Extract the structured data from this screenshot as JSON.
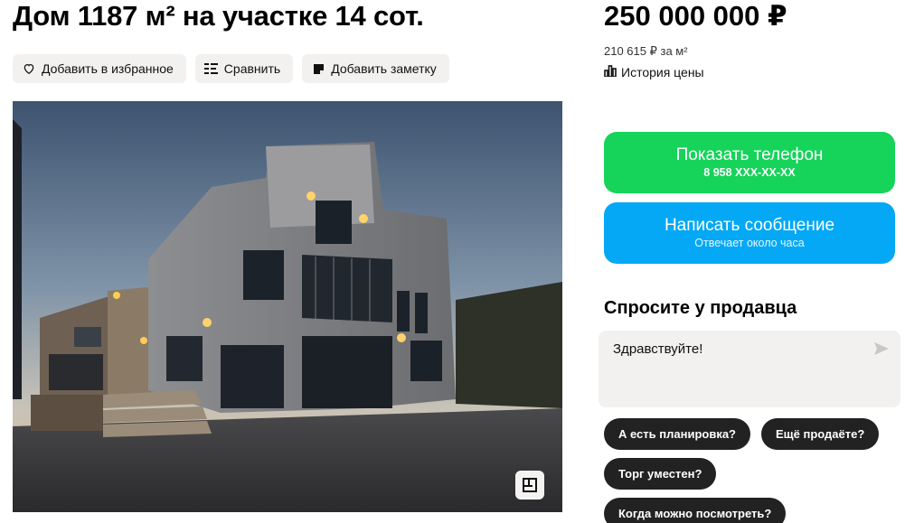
{
  "listing": {
    "title": "Дом 1187 м² на участке 14 сот."
  },
  "actions": [
    {
      "label": "Добавить в избранное",
      "icon": "heart-icon"
    },
    {
      "label": "Сравнить",
      "icon": "compare-icon"
    },
    {
      "label": "Добавить заметку",
      "icon": "note-icon"
    }
  ],
  "price": {
    "total": "250 000 000 ₽",
    "per_m2": "210 615 ₽ за м²",
    "history_label": "История цены"
  },
  "contact": {
    "phone_label": "Показать телефон",
    "phone_masked": "8 958 XXX-XX-XX",
    "phone_color": "#16d35a",
    "message_label": "Написать сообщение",
    "message_sub": "Отвечает около часа",
    "message_color": "#04a8f5"
  },
  "ask_seller": {
    "title": "Спросите у продавца",
    "message_text": "Здравствуйте!",
    "quick_replies": [
      "А есть планировка?",
      "Ещё продаёте?",
      "Торг уместен?",
      "Когда можно посмотреть?"
    ]
  },
  "photo": {
    "plan_icon": "floorplan-icon"
  }
}
